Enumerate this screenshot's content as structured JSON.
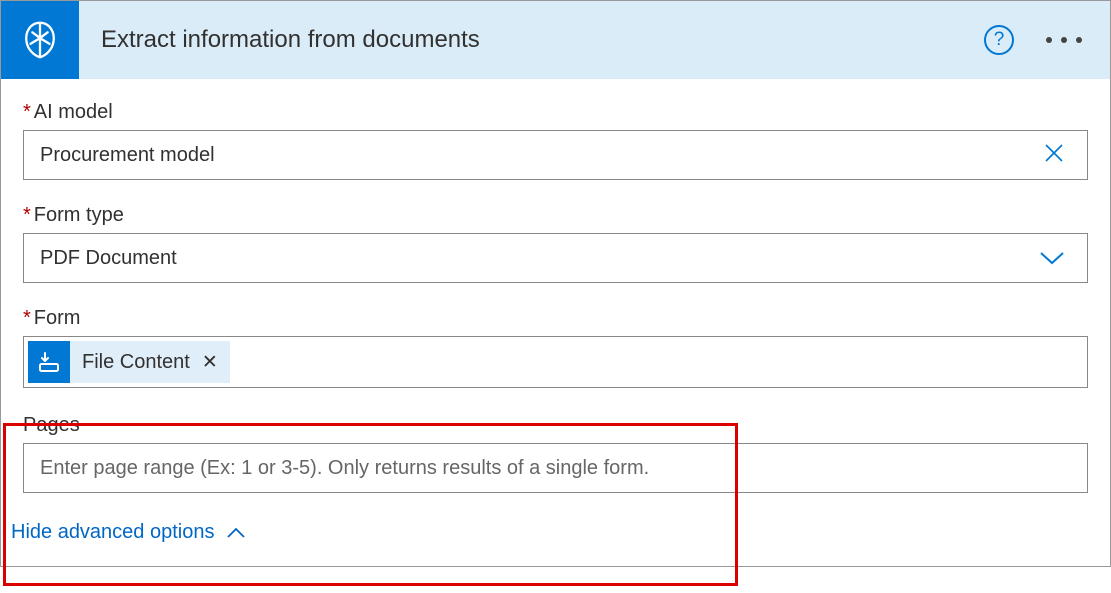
{
  "header": {
    "title": "Extract information from documents"
  },
  "fields": {
    "ai_model": {
      "label": "AI model",
      "value": "Procurement model"
    },
    "form_type": {
      "label": "Form type",
      "value": "PDF Document"
    },
    "form": {
      "label": "Form",
      "token": "File Content"
    },
    "pages": {
      "label": "Pages",
      "placeholder": "Enter page range (Ex: 1 or 3-5). Only returns results of a single form."
    }
  },
  "advanced": {
    "toggle_label": "Hide advanced options"
  }
}
